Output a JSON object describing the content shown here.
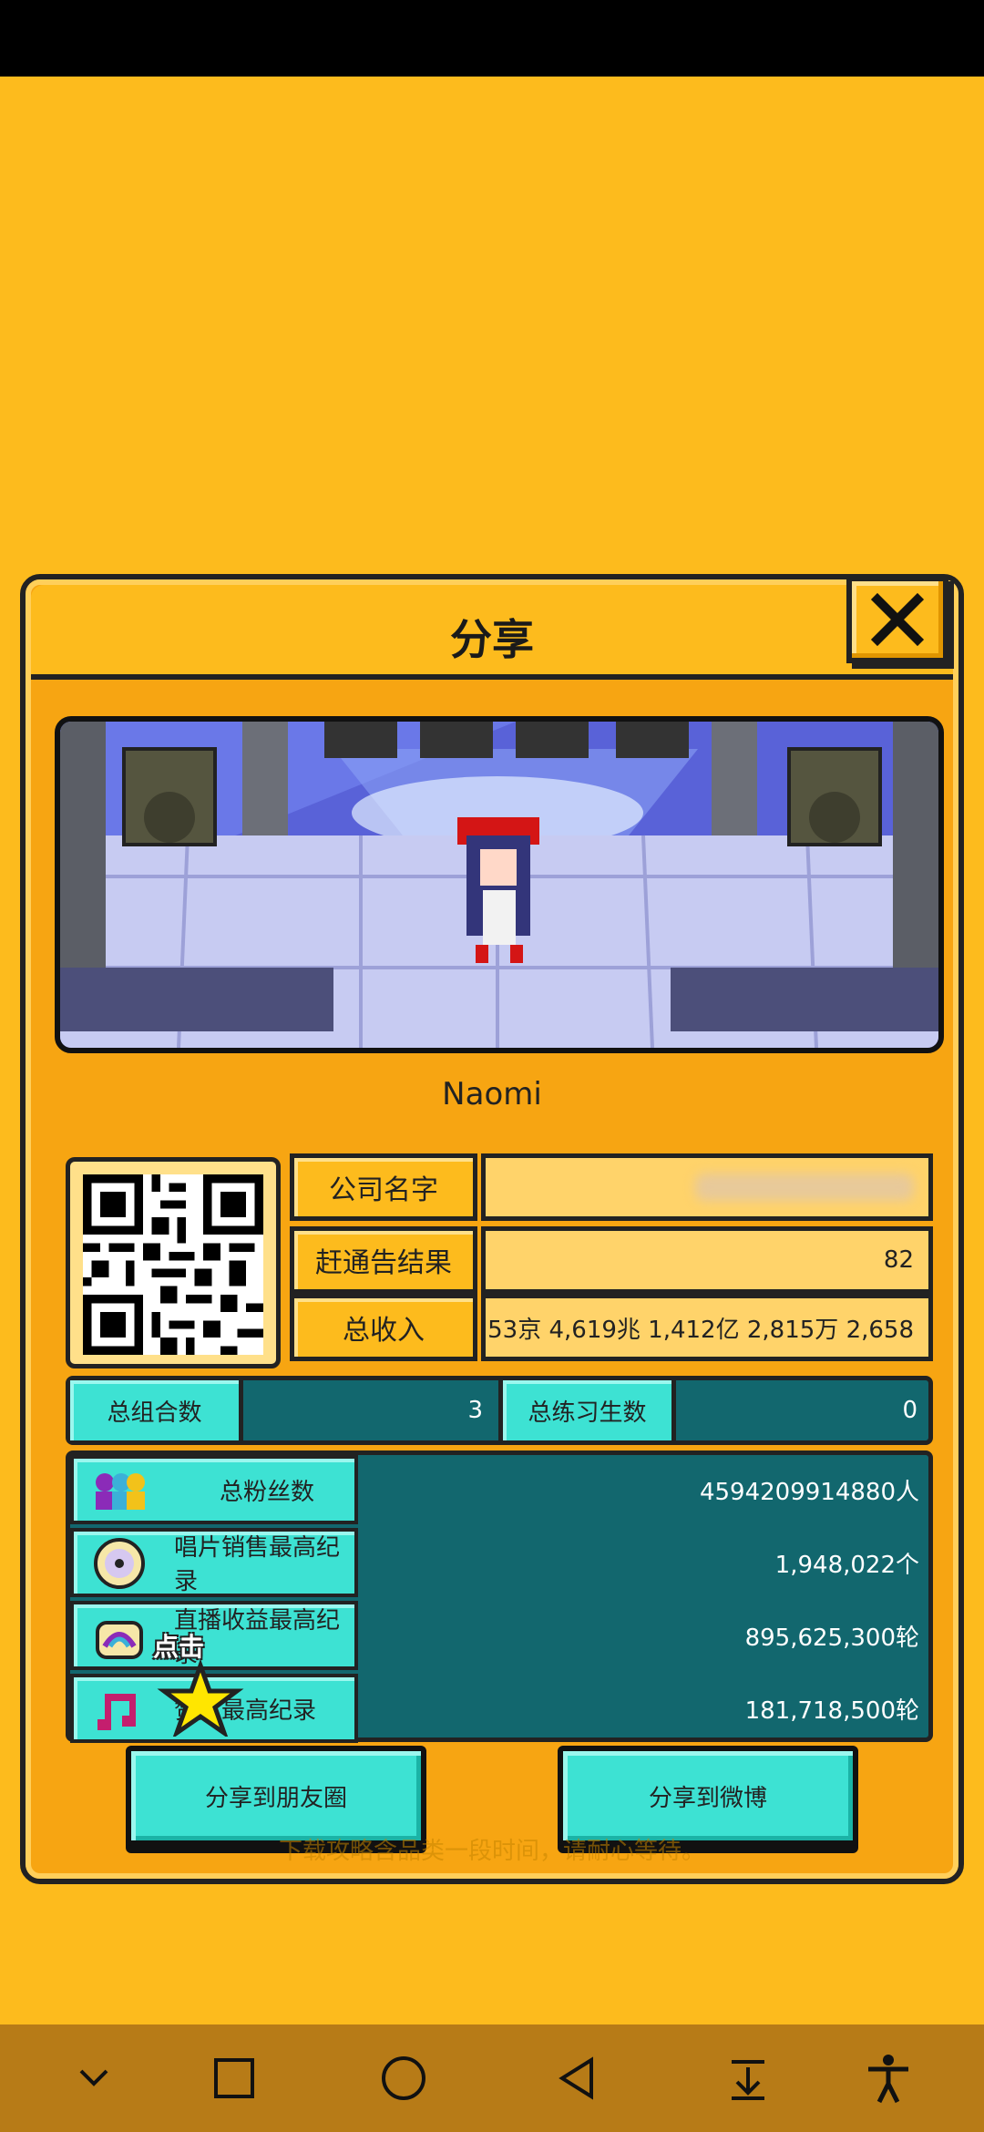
{
  "dialog": {
    "title": "分享",
    "character_name": "Naomi"
  },
  "info": {
    "rows": [
      {
        "label": "公司名字",
        "value": ""
      },
      {
        "label": "赶通告结果",
        "value": "82"
      },
      {
        "label": "总收入",
        "value": "53京 4,619兆 1,412亿 2,815万 2,658"
      }
    ]
  },
  "stats": {
    "groups_label": "总组合数",
    "groups_value": "3",
    "trainees_label": "总练习生数",
    "trainees_value": "0"
  },
  "records": [
    {
      "label": "总粉丝数",
      "value": "4594209914880人",
      "icon": "fans-icon"
    },
    {
      "label": "唱片销售最高纪录",
      "value": "1,948,022个",
      "icon": "disc-icon"
    },
    {
      "label": "直播收益最高纪录",
      "value": "895,625,300轮",
      "icon": "live-stream-icon"
    },
    {
      "label": "赞数最高纪录",
      "value": "181,718,500轮",
      "icon": "music-note-icon"
    }
  ],
  "tap_hint": "点击",
  "share": {
    "moments_label": "分享到朋友圈",
    "weibo_label": "分享到微博"
  },
  "faint_text": "下载攻略含品类一段时间，请耐心等待。",
  "colors": {
    "background": "#FDBB1D",
    "dialog": "#F7A512",
    "teal_dark": "#12676E",
    "teal_light": "#3DE2D3",
    "nav_bar": "#B77B17"
  }
}
